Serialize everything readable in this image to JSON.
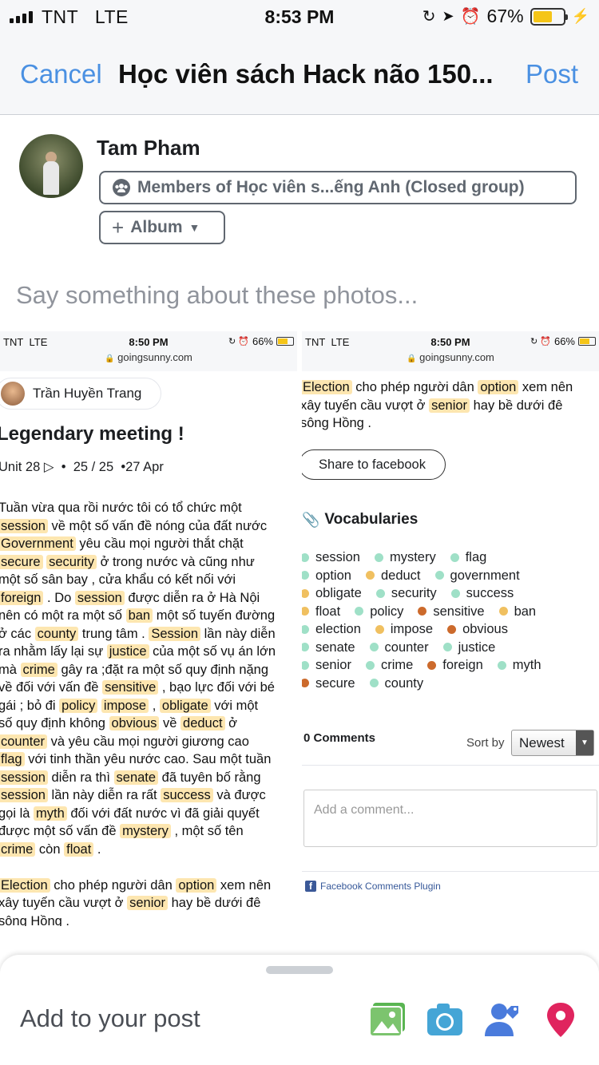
{
  "status_bar": {
    "carrier": "TNT",
    "network": "LTE",
    "time": "8:53 PM",
    "battery": "67%"
  },
  "nav": {
    "cancel": "Cancel",
    "title": "Học viên sách Hack não 150...",
    "post": "Post"
  },
  "composer": {
    "user_name": "Tam Pham",
    "audience": "Members of Học viên s...ếng Anh (Closed group)",
    "album": "Album",
    "placeholder": "Say something about these photos..."
  },
  "photo_left": {
    "status": {
      "carrier": "TNT",
      "network": "LTE",
      "time": "8:50 PM",
      "battery": "66%",
      "url": "goingsunny.com"
    },
    "author": "Trần Huyền Trang",
    "title": "Legendary meeting !",
    "meta": {
      "unit": "Unit 28",
      "score": "25 / 25",
      "date": "27 Apr"
    },
    "lines": [
      [
        [
          "Tuần vừa qua rồi nước tôi có tổ chức một",
          false
        ]
      ],
      [
        [
          "session",
          true
        ],
        [
          " về một số vấn đề nóng của đất nước",
          false
        ]
      ],
      [
        [
          "Government",
          true
        ],
        [
          " yêu cầu mọi người thắt chặt",
          false
        ]
      ],
      [
        [
          "secure",
          true
        ],
        [
          " ",
          false
        ],
        [
          "security",
          true
        ],
        [
          " ở trong nước và cũng như",
          false
        ]
      ],
      [
        [
          "một số sân bay , cửa khẩu có kết nối với",
          false
        ]
      ],
      [
        [
          "foreign",
          true
        ],
        [
          " . Do ",
          false
        ],
        [
          "session",
          true
        ],
        [
          " được diễn ra ở Hà Nội",
          false
        ]
      ],
      [
        [
          "nên có một ra một số ",
          false
        ],
        [
          "ban",
          true
        ],
        [
          " một số tuyến đường",
          false
        ]
      ],
      [
        [
          "ở các ",
          false
        ],
        [
          "county",
          true
        ],
        [
          " trung tâm . ",
          false
        ],
        [
          "Session",
          true
        ],
        [
          " lần này diễn",
          false
        ]
      ],
      [
        [
          "ra nhằm lấy lại sự ",
          false
        ],
        [
          "justice",
          true
        ],
        [
          " của một số vụ án lớn",
          false
        ]
      ],
      [
        [
          "mà ",
          false
        ],
        [
          "crime",
          true
        ],
        [
          " gây ra ;đặt ra một số quy định nặng",
          false
        ]
      ],
      [
        [
          "về đối với vấn đề ",
          false
        ],
        [
          "sensitive",
          true
        ],
        [
          " , bạo lực đối với bé",
          false
        ]
      ],
      [
        [
          "gái ; bỏ đi ",
          false
        ],
        [
          "policy",
          true
        ],
        [
          " ",
          false
        ],
        [
          "impose",
          true
        ],
        [
          " , ",
          false
        ],
        [
          "obligate",
          true
        ],
        [
          " với một",
          false
        ]
      ],
      [
        [
          "số quy định không ",
          false
        ],
        [
          "obvious",
          true
        ],
        [
          " về ",
          false
        ],
        [
          "deduct",
          true
        ],
        [
          " ở",
          false
        ]
      ],
      [
        [
          "counter",
          true
        ],
        [
          " và yêu cầu mọi người giương cao",
          false
        ]
      ],
      [
        [
          "flag",
          true
        ],
        [
          " với tinh thần yêu nước cao. Sau một tuần",
          false
        ]
      ],
      [
        [
          "session",
          true
        ],
        [
          " diễn ra thì ",
          false
        ],
        [
          "senate",
          true
        ],
        [
          " đã tuyên bố rằng",
          false
        ]
      ],
      [
        [
          "session",
          true
        ],
        [
          " lần này diễn ra rất ",
          false
        ],
        [
          "success",
          true
        ],
        [
          " và được",
          false
        ]
      ],
      [
        [
          "gọi là ",
          false
        ],
        [
          "myth",
          true
        ],
        [
          " đối với đất nước vì đã giải quyết",
          false
        ]
      ],
      [
        [
          "được một số vấn đề ",
          false
        ],
        [
          "mystery",
          true
        ],
        [
          " , một số tên",
          false
        ]
      ],
      [
        [
          "crime",
          true
        ],
        [
          " còn ",
          false
        ],
        [
          "float",
          true
        ],
        [
          " .",
          false
        ]
      ],
      [
        [
          "",
          false
        ]
      ],
      [
        [
          "Election",
          true
        ],
        [
          " cho phép người dân ",
          false
        ],
        [
          "option",
          true
        ],
        [
          " xem nên",
          false
        ]
      ],
      [
        [
          "xây tuyến cầu vượt ở ",
          false
        ],
        [
          "senior",
          true
        ],
        [
          " hay bề dưới đê",
          false
        ]
      ],
      [
        [
          "sông Hồng .",
          false
        ]
      ]
    ]
  },
  "photo_right": {
    "status": {
      "carrier": "TNT",
      "network": "LTE",
      "time": "8:50 PM",
      "battery": "66%",
      "url": "goingsunny.com"
    },
    "lines": [
      [
        [
          "Election",
          true
        ],
        [
          " cho phép người dân ",
          false
        ],
        [
          "option",
          true
        ],
        [
          " xem nên",
          false
        ]
      ],
      [
        [
          "xây tuyến cầu vượt ở ",
          false
        ],
        [
          "senior",
          true
        ],
        [
          " hay bề dưới đê",
          false
        ]
      ],
      [
        [
          "sông Hồng .",
          false
        ]
      ]
    ],
    "share_button": "Share to facebook",
    "vocab_title": "Vocabularies",
    "vocab_rows": [
      [
        [
          "session",
          "green"
        ],
        [
          "mystery",
          "green"
        ],
        [
          "flag",
          "green"
        ]
      ],
      [
        [
          "option",
          "green"
        ],
        [
          "deduct",
          "yellow"
        ],
        [
          "government",
          "green"
        ]
      ],
      [
        [
          "obligate",
          "yellow"
        ],
        [
          "security",
          "green"
        ],
        [
          "success",
          "green"
        ]
      ],
      [
        [
          "float",
          "yellow"
        ],
        [
          "policy",
          "green"
        ],
        [
          "sensitive",
          "red"
        ],
        [
          "ban",
          "yellow"
        ]
      ],
      [
        [
          "election",
          "green"
        ],
        [
          "impose",
          "yellow"
        ],
        [
          "obvious",
          "red"
        ]
      ],
      [
        [
          "senate",
          "green"
        ],
        [
          "counter",
          "green"
        ],
        [
          "justice",
          "green"
        ]
      ],
      [
        [
          "senior",
          "green"
        ],
        [
          "crime",
          "green"
        ],
        [
          "foreign",
          "red"
        ],
        [
          "myth",
          "green"
        ]
      ],
      [
        [
          "secure",
          "red"
        ],
        [
          "county",
          "green"
        ]
      ]
    ],
    "comments_count": "0 Comments",
    "sort_by": "Sort by",
    "sort_value": "Newest",
    "comment_placeholder": "Add a comment...",
    "plugin_label": "Facebook Comments Plugin"
  },
  "bottom": {
    "add_to_post": "Add to your post"
  }
}
